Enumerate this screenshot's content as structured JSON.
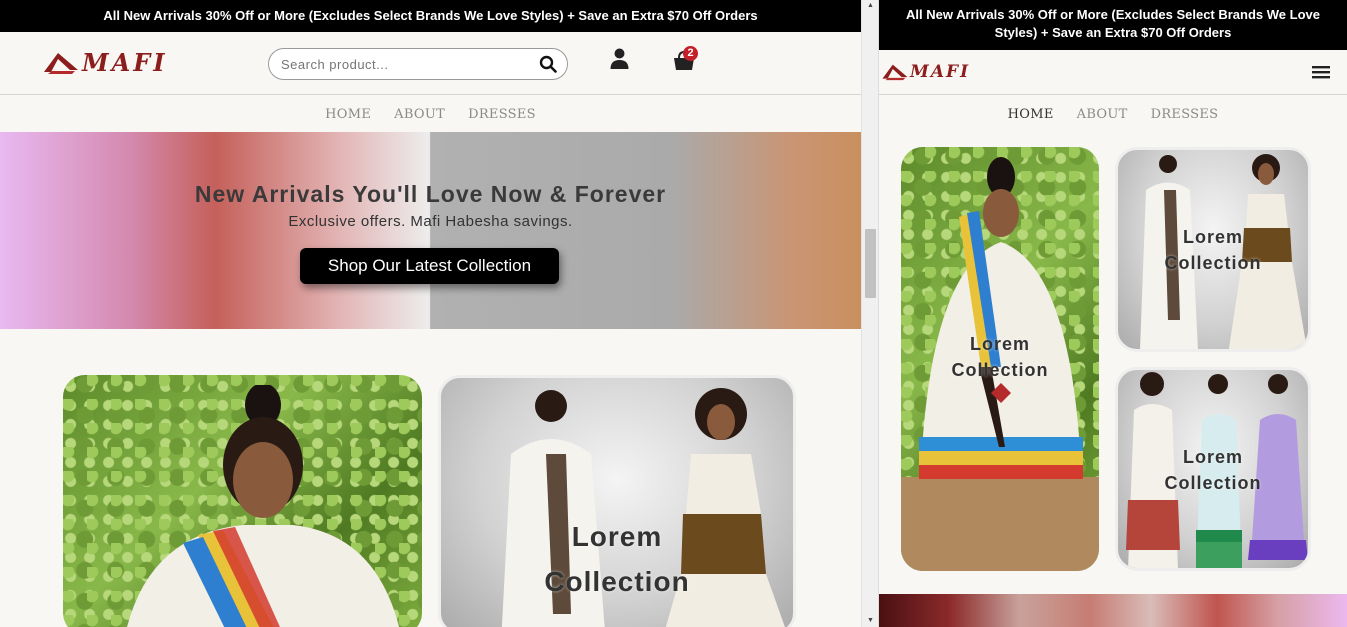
{
  "promo_text": "All New Arrivals 30% Off or More (Excludes Select Brands We Love Styles) + Save an Extra $70 Off Orders",
  "logo_text": "MAFI",
  "search": {
    "placeholder": "Search product..."
  },
  "cart": {
    "count": "2"
  },
  "nav": {
    "home": "HOME",
    "about": "ABOUT",
    "dresses": "DRESSES"
  },
  "hero": {
    "title": "New Arrivals You'll Love Now & Forever",
    "subtitle": "Exclusive offers. Mafi Habesha savings.",
    "button": "Shop Our Latest Collection"
  },
  "collections": {
    "collection_a": {
      "line1": "Lorem",
      "line2": "Collection"
    },
    "collection_b": {
      "line1": "Lorem",
      "line2": "Collection"
    },
    "collection_c": {
      "line1": "Lorem",
      "line2": "Collection"
    }
  },
  "colors": {
    "brand": "#8c1d1d",
    "promo_bg": "#000000",
    "page_bg": "#f8f7f3",
    "badge": "#c41e2a"
  },
  "icons": [
    "search-icon",
    "user-icon",
    "cart-icon",
    "hamburger-menu-icon",
    "logo-mark-icon"
  ]
}
